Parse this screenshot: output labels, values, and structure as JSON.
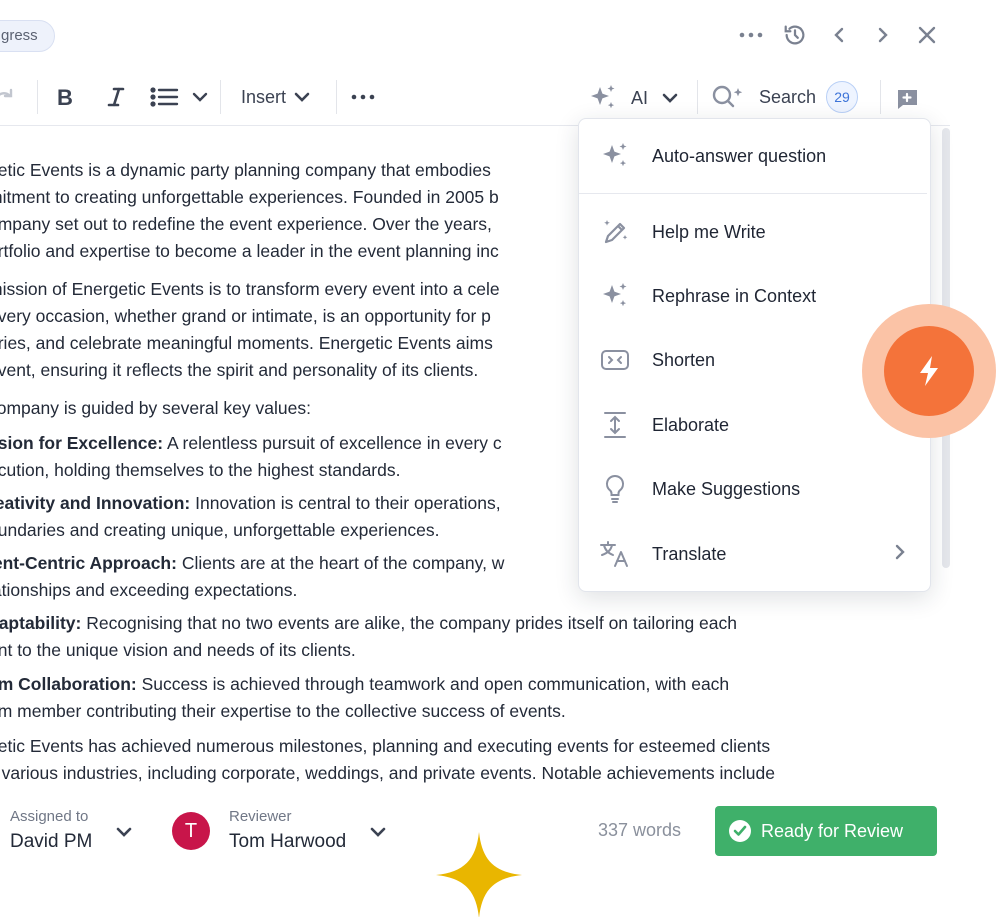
{
  "header": {
    "status": "gress"
  },
  "toolbar": {
    "insert_label": "Insert",
    "ai_label": "AI",
    "search_label": "Search",
    "search_count": "29"
  },
  "document": {
    "lines": [
      "getic Events is a dynamic party planning company that embodies",
      "mitment to creating unforgettable experiences. Founded in 2005 b",
      "ompany set out to redefine the event experience. Over the years,",
      "ortfolio and expertise to become a leader in the event planning inc",
      "mission of Energetic Events is to transform every event into a cele",
      "every occasion, whether grand or intimate, is an opportunity for p",
      "ories, and celebrate meaningful moments. Energetic Events aims",
      " event, ensuring it reflects the spirit and personality of its clients.",
      "company is guided by several key values:"
    ],
    "values": [
      {
        "title": "ssion for Excellence:",
        "text": " A relentless pursuit of excellence in every c",
        "cont": "ecution, holding themselves to the highest standards."
      },
      {
        "title": "reativity and Innovation:",
        "text": " Innovation is central to their operations,",
        "cont": "oundaries and creating unique, unforgettable experiences."
      },
      {
        "title": "ient-Centric Approach:",
        "text": " Clients are at the heart of the company, w",
        "cont": "lationships and exceeding expectations."
      },
      {
        "title": "daptability:",
        "text": " Recognising that no two events are alike, the company prides itself on tailoring each",
        "cont": "ent to the unique vision and needs of its clients."
      },
      {
        "title": "am Collaboration:",
        "text": " Success is achieved through teamwork and open communication, with each",
        "cont": "am member contributing their expertise to the collective success of events."
      }
    ],
    "closing": [
      "getic Events has achieved numerous milestones, planning and executing events for esteemed clients",
      "s various industries, including corporate, weddings, and private events. Notable achievements include"
    ]
  },
  "ai_menu": {
    "items": [
      {
        "label": "Auto-answer question",
        "icon": "sparkles-icon"
      },
      {
        "label": "Help me Write",
        "icon": "magic-pen-icon"
      },
      {
        "label": "Rephrase in Context",
        "icon": "sparkles-icon"
      },
      {
        "label": "Shorten",
        "icon": "shorten-icon"
      },
      {
        "label": "Elaborate",
        "icon": "elaborate-icon"
      },
      {
        "label": "Make Suggestions",
        "icon": "lightbulb-icon"
      },
      {
        "label": "Translate",
        "icon": "translate-icon"
      }
    ]
  },
  "footer": {
    "assigned_label": "Assigned to",
    "assigned_value": "David PM",
    "reviewer_label": "Reviewer",
    "reviewer_value": "Tom Harwood",
    "reviewer_initial": "T",
    "word_count": "337 words",
    "ready_label": "Ready for Review"
  },
  "colors": {
    "accent_orange": "#f4733a",
    "ready_green": "#3fb06a",
    "avatar_red": "#c8154a",
    "sparkle_yellow": "#e9b600"
  }
}
